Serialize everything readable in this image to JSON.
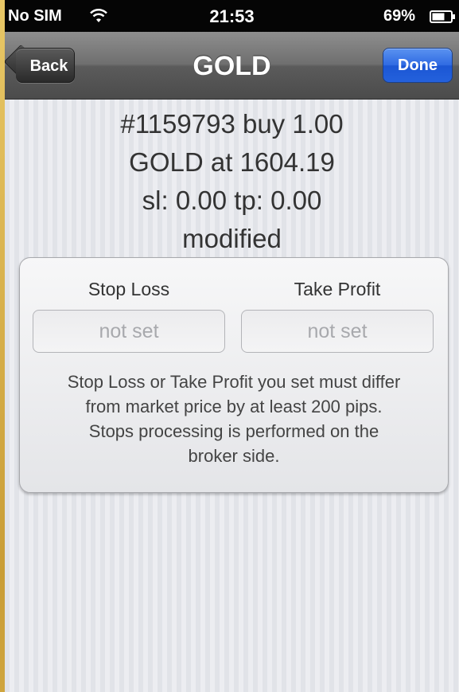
{
  "status_bar": {
    "carrier": "No SIM",
    "time": "21:53",
    "battery": "69%",
    "icons": [
      "wifi-icon",
      "battery-icon"
    ]
  },
  "nav": {
    "back_label": "Back",
    "title": "GOLD",
    "done_label": "Done"
  },
  "order": {
    "line1": "#1159793 buy 1.00",
    "line2": "GOLD at 1604.19",
    "line3": "sl: 0.00 tp: 0.00",
    "line4": "modified"
  },
  "form": {
    "stop_loss_label": "Stop Loss",
    "stop_loss_placeholder": "not set",
    "take_profit_label": "Take Profit",
    "take_profit_placeholder": "not set",
    "hint_line1": "Stop Loss or Take Profit you set must differ",
    "hint_line2": "from market price by at least 200 pips.",
    "hint_line3": "Stops processing is performed on the",
    "hint_line4": "broker side."
  },
  "colors": {
    "accent_blue": "#2f6ae2",
    "nav_gray": "#6f6f6f",
    "frame_gold": "#d9b44a"
  }
}
